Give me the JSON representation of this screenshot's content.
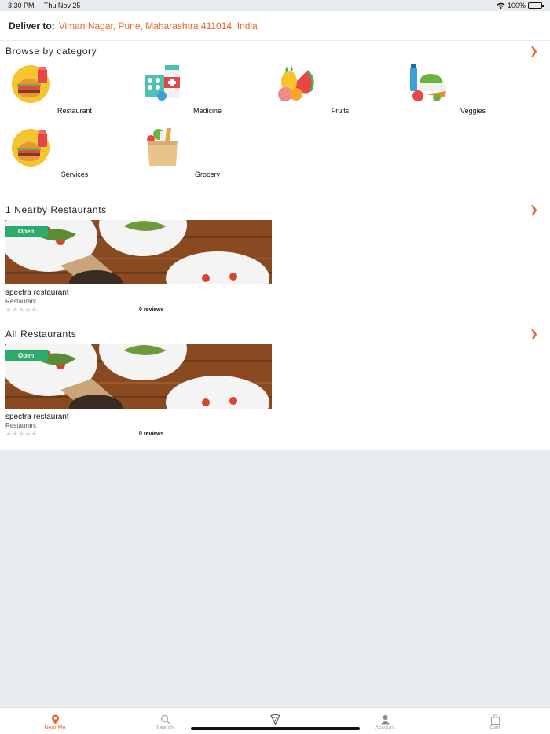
{
  "status": {
    "time": "3:30 PM",
    "date": "Thu Nov 25",
    "battery": "100%"
  },
  "deliver": {
    "label": "Deliver to:",
    "address": "Viman Nagar, Pune, Maharashtra 411014, India"
  },
  "browse": {
    "title": "Browse by category",
    "categories": [
      {
        "name": "Restaurant",
        "icon": "burger-icon"
      },
      {
        "name": "Medicine",
        "icon": "medicine-icon"
      },
      {
        "name": "Fruits",
        "icon": "fruits-icon"
      },
      {
        "name": "Veggies",
        "icon": "veggies-icon"
      },
      {
        "name": "Services",
        "icon": "burger-icon"
      },
      {
        "name": "Grocery",
        "icon": "grocery-bag-icon"
      }
    ]
  },
  "nearby": {
    "title": "1 Nearby Restaurants",
    "card": {
      "badge": "Open",
      "name": "spectra restaurant",
      "type": "Restaurant",
      "reviews": "0 reviews",
      "rating": 0
    }
  },
  "all": {
    "title": "All Restaurants",
    "card": {
      "badge": "Open",
      "name": "spectra restaurant",
      "type": "Restaurant",
      "reviews": "0 reviews",
      "rating": 0
    }
  },
  "tabs": [
    {
      "label": "Near Me",
      "icon": "location-pin-icon",
      "active": true
    },
    {
      "label": "Search",
      "icon": "search-icon",
      "active": false
    },
    {
      "label": "",
      "icon": "pizza-slice-icon",
      "active": false
    },
    {
      "label": "Account",
      "icon": "account-icon",
      "active": false
    },
    {
      "label": "Cart",
      "icon": "cart-bag-icon",
      "active": false
    }
  ],
  "colors": {
    "accent": "#e8672a",
    "open_badge": "#2eaa6d"
  }
}
